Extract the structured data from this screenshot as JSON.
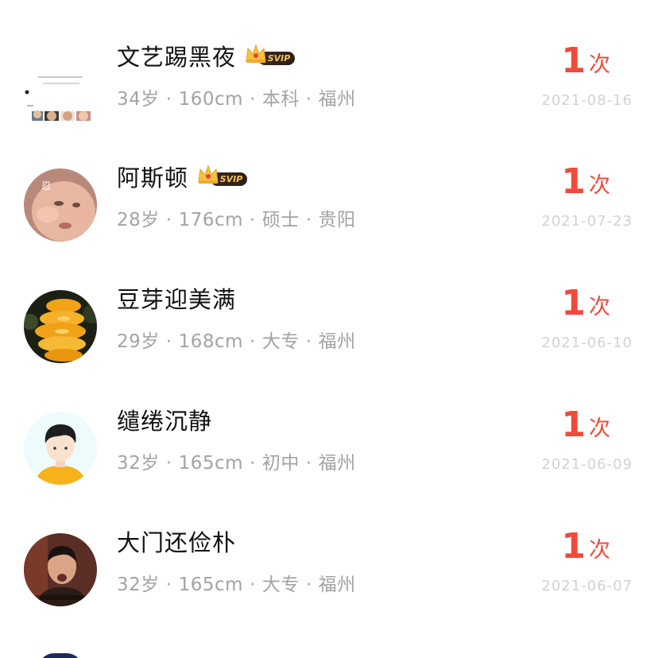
{
  "list": {
    "items": [
      {
        "name": "文艺踢黑夜",
        "svip": true,
        "svip_label": "SVIP",
        "age": "34岁",
        "height": "160cm",
        "education": "本科",
        "city": "福州",
        "count": "1",
        "count_unit": "次",
        "date": "2021-08-16",
        "avatar_icon": "collage-photo-avatar"
      },
      {
        "name": "阿斯顿",
        "svip": true,
        "svip_label": "SVIP",
        "age": "28岁",
        "height": "176cm",
        "education": "硕士",
        "city": "贵阳",
        "count": "1",
        "count_unit": "次",
        "date": "2021-07-23",
        "avatar_icon": "baby-photo-avatar"
      },
      {
        "name": "豆芽迎美满",
        "svip": false,
        "age": "29岁",
        "height": "168cm",
        "education": "大专",
        "city": "福州",
        "count": "1",
        "count_unit": "次",
        "date": "2021-06-10",
        "avatar_icon": "fruit-slices-avatar"
      },
      {
        "name": "缱绻沉静",
        "svip": false,
        "age": "32岁",
        "height": "165cm",
        "education": "初中",
        "city": "福州",
        "count": "1",
        "count_unit": "次",
        "date": "2021-06-09",
        "avatar_icon": "default-male-avatar"
      },
      {
        "name": "大门还俭朴",
        "svip": false,
        "age": "32岁",
        "height": "165cm",
        "education": "大专",
        "city": "福州",
        "count": "1",
        "count_unit": "次",
        "date": "2021-06-07",
        "avatar_icon": "man-photo-avatar"
      }
    ]
  },
  "colors": {
    "accent_red": "#f04a3b",
    "meta_gray": "#a3a3a3",
    "date_gray": "#d2d2d2",
    "svip_gold": "#f3c15a"
  }
}
